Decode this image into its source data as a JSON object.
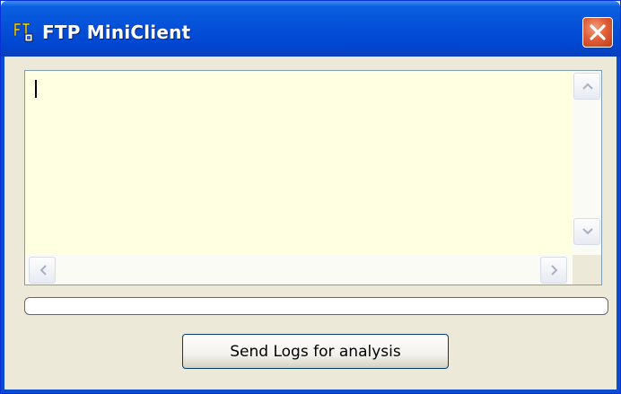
{
  "window": {
    "title": "FTP MiniClient",
    "icon": "ftp-app-icon",
    "close_icon": "close-icon"
  },
  "log": {
    "content": "",
    "background": "#ffffe1"
  },
  "progress": {
    "value": 0.0
  },
  "actions": {
    "send_logs_label": "Send Logs for analysis"
  },
  "colors": {
    "titlebar": "#0551d8",
    "close_button": "#e0603a",
    "window_bg": "#ece9d8"
  }
}
